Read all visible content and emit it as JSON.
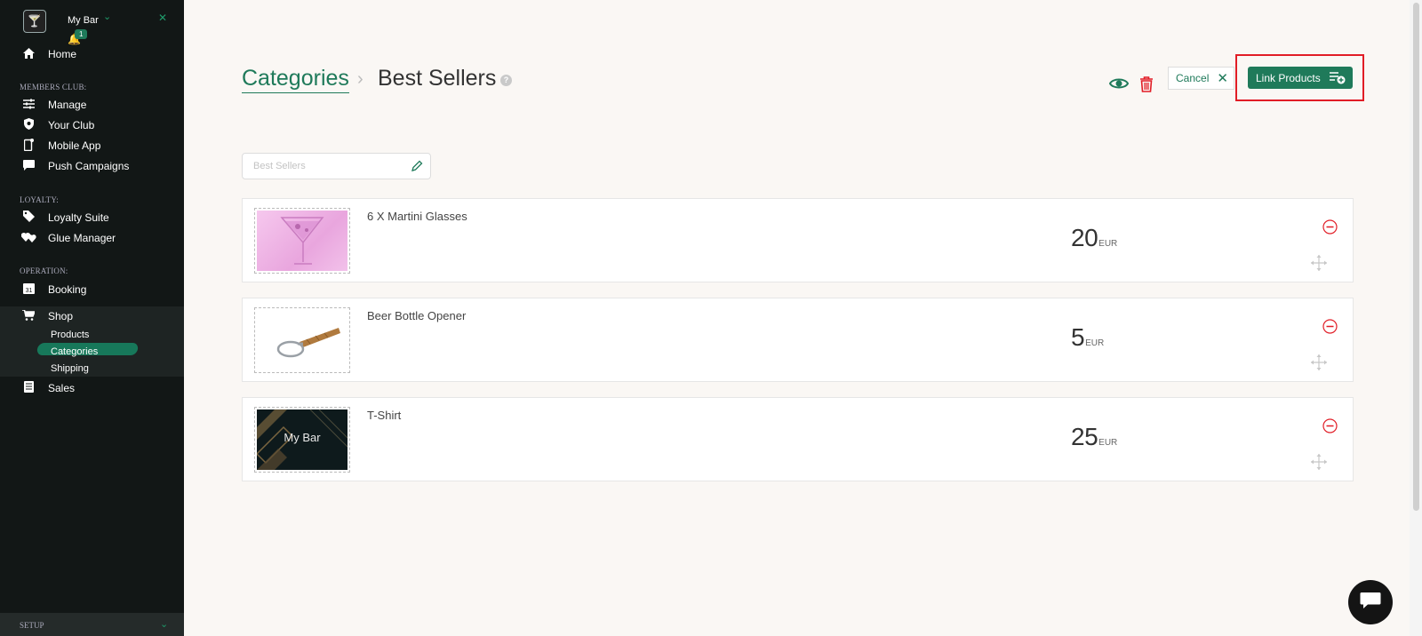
{
  "sidebar": {
    "bar_name": "My Bar",
    "notification_count": "1",
    "home_label": "Home",
    "members_section": "MEMBERS CLUB:",
    "members_items": [
      {
        "label": "Manage",
        "icon": "sliders-icon"
      },
      {
        "label": "Your Club",
        "icon": "shield-icon"
      },
      {
        "label": "Mobile App",
        "icon": "mobile-icon"
      },
      {
        "label": "Push Campaigns",
        "icon": "chat-bubble-icon"
      }
    ],
    "loyalty_section": "LOYALTY:",
    "loyalty_items": [
      {
        "label": "Loyalty Suite",
        "icon": "tag-icon"
      },
      {
        "label": "Glue Manager",
        "icon": "hearts-icon"
      }
    ],
    "operation_section": "OPERATION:",
    "booking_label": "Booking",
    "booking_icon_text": "31",
    "shop_label": "Shop",
    "shop_sub": [
      "Products",
      "Categories",
      "Shipping"
    ],
    "sales_label": "Sales",
    "setup_label": "SETUP"
  },
  "header": {
    "breadcrumb_parent": "Categories",
    "breadcrumb_separator": "›",
    "breadcrumb_current": "Best Sellers",
    "help_glyph": "?",
    "cancel_label": "Cancel",
    "link_products_label": "Link Products"
  },
  "category_name": {
    "value": "",
    "placeholder": "Best Sellers"
  },
  "products": [
    {
      "name": "6 X Martini Glasses",
      "price": "20",
      "currency": "EUR",
      "image": "martini-glass-image"
    },
    {
      "name": "Beer Bottle Opener",
      "price": "5",
      "currency": "EUR",
      "image": "bottle-opener-image"
    },
    {
      "name": "T-Shirt",
      "price": "25",
      "currency": "EUR",
      "image": "tshirt-image",
      "image_text": "My Bar"
    }
  ],
  "colors": {
    "accent": "#1f7a5a",
    "danger": "#e11d26",
    "sidebar_bg": "#121716",
    "page_bg": "#faf7f4"
  }
}
